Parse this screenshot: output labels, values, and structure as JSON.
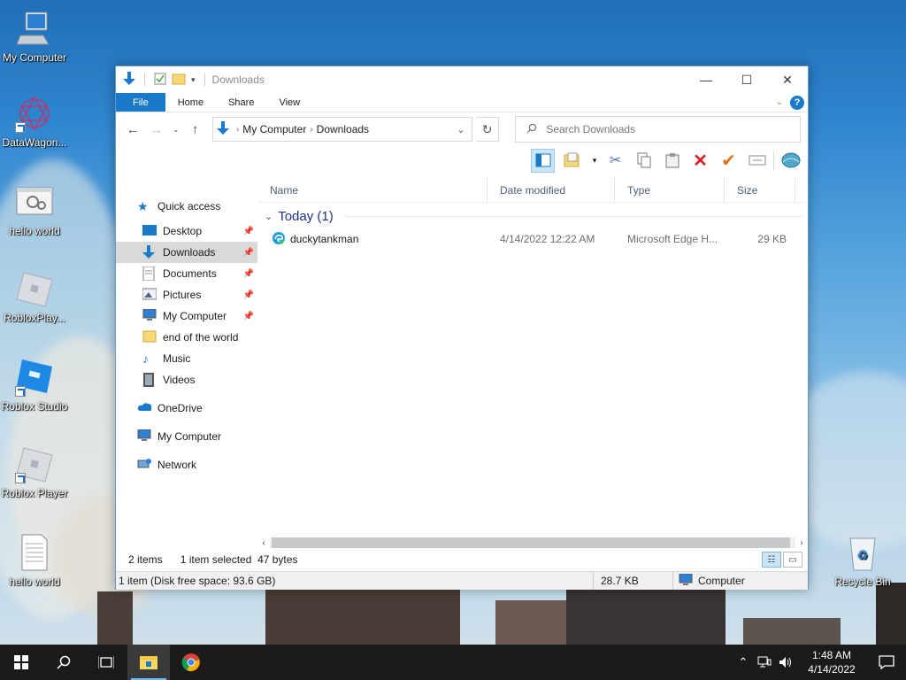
{
  "desktop": {
    "icons": [
      {
        "label": "My Computer"
      },
      {
        "label": "DataWagon..."
      },
      {
        "label": "hello world"
      },
      {
        "label": "RobloxPlay..."
      },
      {
        "label": "Roblox Studio"
      },
      {
        "label": "Roblox Player"
      },
      {
        "label": "hello world"
      },
      {
        "label": "Recycle Bin"
      }
    ]
  },
  "explorer": {
    "title": "Downloads",
    "ribbon": {
      "file": "File",
      "home": "Home",
      "share": "Share",
      "view": "View"
    },
    "address": {
      "root": "My Computer",
      "current": "Downloads"
    },
    "search": {
      "placeholder": "Search Downloads"
    },
    "nav": {
      "quick_access": "Quick access",
      "items": [
        {
          "label": "Desktop",
          "pinned": true
        },
        {
          "label": "Downloads",
          "pinned": true,
          "selected": true
        },
        {
          "label": "Documents",
          "pinned": true
        },
        {
          "label": "Pictures",
          "pinned": true
        },
        {
          "label": "My Computer",
          "pinned": true
        },
        {
          "label": "end of the world",
          "pinned": false
        },
        {
          "label": "Music",
          "pinned": false
        },
        {
          "label": "Videos",
          "pinned": false
        }
      ],
      "onedrive": "OneDrive",
      "my_computer": "My Computer",
      "network": "Network"
    },
    "columns": {
      "name": "Name",
      "date": "Date modified",
      "type": "Type",
      "size": "Size"
    },
    "group": "Today (1)",
    "files": [
      {
        "name": "duckytankman",
        "date": "4/14/2022 12:22 AM",
        "type": "Microsoft Edge H...",
        "size": "29 KB"
      }
    ],
    "status": {
      "items": "2 items",
      "selected": "1 item selected",
      "bytes": "47 bytes"
    },
    "statusbar": {
      "info": "1 item (Disk free space: 93.6 GB)",
      "size": "28.7 KB",
      "location": "Computer"
    }
  },
  "taskbar": {
    "time": "1:48 AM",
    "date": "4/14/2022"
  }
}
